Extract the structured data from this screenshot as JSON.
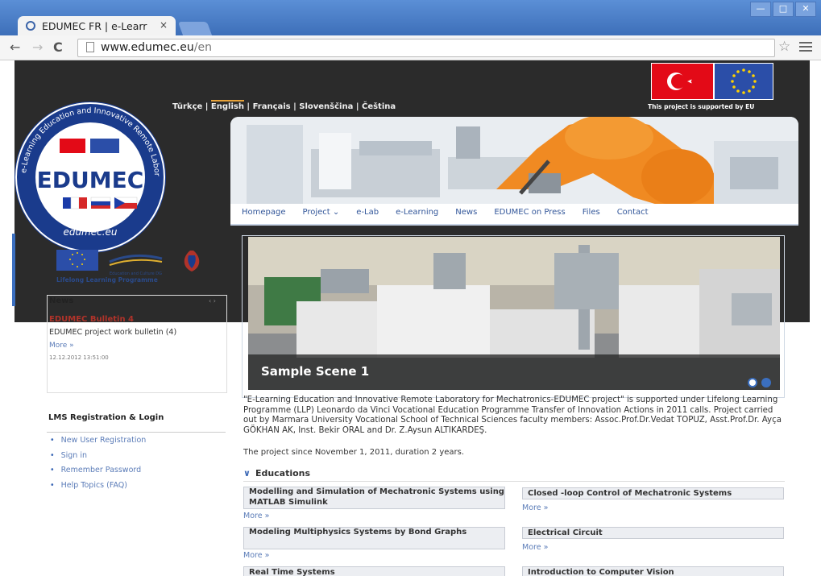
{
  "browser": {
    "tab_title": "EDUMEC FR | e-Learr",
    "tab_close": "×",
    "url_host": "www.edumec.eu",
    "url_path": "/en",
    "window_controls": [
      "—",
      "□",
      "✕"
    ]
  },
  "header": {
    "languages": [
      "Türkçe",
      "English",
      "Français",
      "Slovenščina",
      "Čeština"
    ],
    "active_language": "English",
    "eu_support": "This project is supported by EU"
  },
  "logo": {
    "ring_text": "e-Learning Education and Innovative Remote Laboratory for Mechatronics",
    "name": "EDUMEC",
    "site": "edumec.eu"
  },
  "nav": {
    "items": [
      "Homepage",
      "Project ⌄",
      "e-Lab",
      "e-Learning",
      "News",
      "EDUMEC on Press",
      "Files",
      "Contact"
    ]
  },
  "partners": {
    "llp": "Lifelong Learning Programme",
    "dg": "Education and Culture DG"
  },
  "news": {
    "title": "News",
    "arrows": "‹ ›",
    "item_title": "EDUMEC Bulletin 4",
    "item_text": "EDUMEC project work bulletin (4)",
    "more": "More »",
    "date": "12.12.2012 13:51:00"
  },
  "lms": {
    "title": "LMS Registration & Login",
    "links": [
      "New User Registration",
      "Sign in",
      "Remember Password",
      "Help Topics (FAQ)"
    ]
  },
  "slider": {
    "caption": "Sample Scene 1"
  },
  "intro": {
    "text": "\"E-Learning Education and Innovative Remote Laboratory for Mechatronics-EDUMEC project\" is supported under Lifelong Learning Programme (LLP) Leonardo da Vinci Vocational Education Programme Transfer of Innovation Actions in 2011 calls. Project carried out by Marmara University Vocational School of Technical Sciences faculty members: Assoc.Prof.Dr.Vedat TOPUZ, Asst.Prof.Dr. Ayça GÖKHAN AK, Inst. Bekir ORAL and Dr. Z.Aysun ALTIKARDEŞ.",
    "since": "The project since November 1, 2011, duration 2 years."
  },
  "educations": {
    "heading": "Educations",
    "more": "More »",
    "courses": [
      "Modelling and Simulation of Mechatronic Systems using MATLAB Simulink",
      "Closed -loop Control of Mechatronic Systems",
      "Modeling Multiphysics Systems by Bond Graphs",
      "Electrical Circuit",
      "Real Time Systems",
      "Introduction to Computer Vision"
    ]
  }
}
